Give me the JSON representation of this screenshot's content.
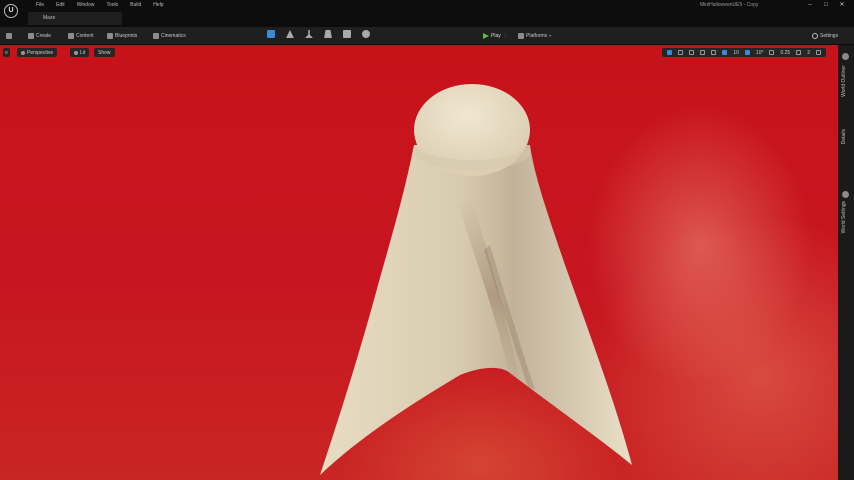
{
  "app": {
    "logo_text": "U",
    "project_title": "MiniHalloweenUE5 - Copy",
    "map_tab": "Maze"
  },
  "menu": [
    "File",
    "Edit",
    "Window",
    "Tools",
    "Build",
    "Help"
  ],
  "window_controls": [
    "–",
    "□",
    "✕"
  ],
  "toolbar": {
    "create": "Create",
    "content": "Content",
    "blueprints": "Blueprints",
    "cinematics": "Cinematics",
    "play": "Play",
    "platforms": "Platforms",
    "settings": "Settings",
    "mode_icons": [
      "select-mode-icon",
      "landscape-icon",
      "foliage-icon",
      "mesh-paint-icon",
      "fracture-icon",
      "modeling-icon"
    ]
  },
  "viewport": {
    "perspective": "Perspective",
    "lit": "Lit",
    "show": "Show",
    "grid_snap": "10",
    "rotation_snap": "10°",
    "scale_snap": "0.25",
    "camera_speed": "2",
    "background_color": "#c8141c",
    "ghost_color": "#dccfb4"
  },
  "side_panel": {
    "tabs": [
      "World Outliner",
      "Details",
      "World Settings"
    ]
  }
}
